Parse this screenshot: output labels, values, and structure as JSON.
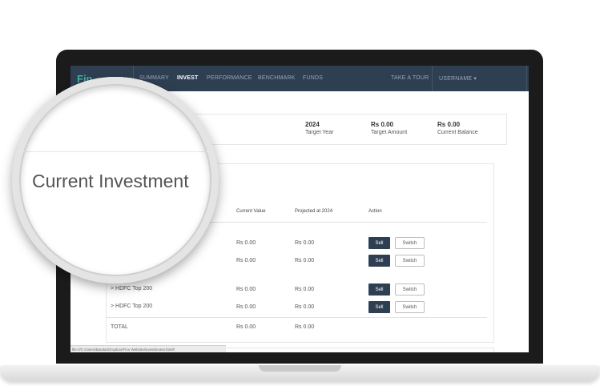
{
  "app": {
    "logo_text": "Fin"
  },
  "nav": {
    "items": [
      {
        "label": "SUMMARY"
      },
      {
        "label": "INVEST"
      },
      {
        "label": "PERFORMANCE"
      },
      {
        "label": "BENCHMARK"
      },
      {
        "label": "FUNDS"
      }
    ],
    "tour_label": "TAKE A TOUR",
    "user_label": "USERNAME ▾"
  },
  "summary": {
    "target_year": {
      "value": "2024",
      "label": "Target Year"
    },
    "target_amount": {
      "value": "Rs 0.00",
      "label": "Target Amount"
    },
    "current_balance": {
      "value": "Rs 0.00",
      "label": "Current Balance"
    }
  },
  "magnifier": {
    "title": "Current Investment"
  },
  "table": {
    "headers": [
      "Current Value",
      "Projected at 2024",
      "Action"
    ],
    "rows": [
      {
        "fund": "",
        "current": "Rs 0.00",
        "projected": "Rs 0.00",
        "sell": "Sell",
        "switch": "Switch"
      },
      {
        "fund": "",
        "current": "Rs 0.00",
        "projected": "Rs 0.00",
        "sell": "Sell",
        "switch": "Switch"
      },
      {
        "fund": "> HDFC Top 200",
        "current": "Rs 0.00",
        "projected": "Rs 0.00",
        "sell": "Sell",
        "switch": "Switch"
      },
      {
        "fund": "> HDFC Top 200",
        "current": "Rs 0.00",
        "projected": "Rs 0.00",
        "sell": "Sell",
        "switch": "Switch"
      }
    ],
    "total": {
      "label": "TOTAL",
      "current": "Rs 0.00",
      "projected": "Rs 0.00"
    }
  },
  "statusbar": {
    "text": "file:///C:/Users/Bandar/Dropbox/Fino Website/invest/invest.html#"
  }
}
